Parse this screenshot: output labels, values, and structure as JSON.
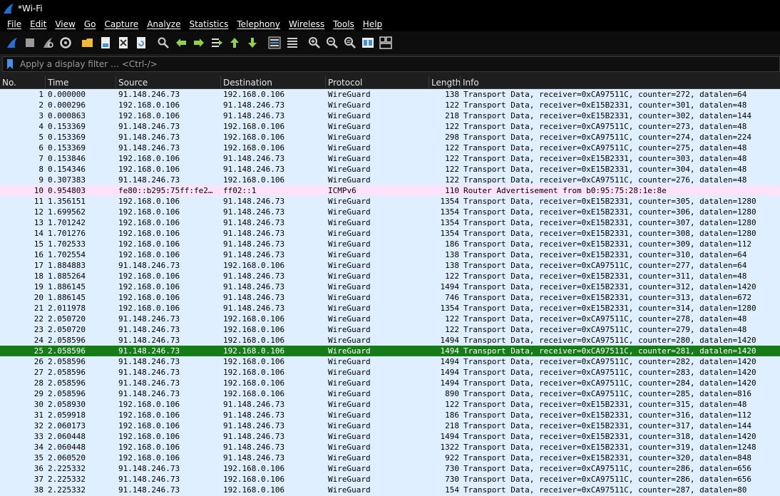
{
  "window": {
    "title": "*Wi-Fi"
  },
  "menu": [
    "File",
    "Edit",
    "View",
    "Go",
    "Capture",
    "Analyze",
    "Statistics",
    "Telephony",
    "Wireless",
    "Tools",
    "Help"
  ],
  "toolbar": [
    {
      "name": "start-capture-icon",
      "color": "#2b6fd6"
    },
    {
      "name": "stop-capture-icon",
      "color": "#9a9a9a"
    },
    {
      "name": "restart-capture-icon",
      "color": "#9a9a9a"
    },
    {
      "name": "capture-options-icon",
      "color": "#d0d0d0"
    },
    {
      "name": "open-file-icon",
      "color": "#f0b93c"
    },
    {
      "name": "save-file-icon",
      "color": "#4a90d9"
    },
    {
      "name": "close-file-icon",
      "color": "#d0d0d0"
    },
    {
      "name": "reload-file-icon",
      "color": "#4a90d9"
    },
    {
      "name": "find-packet-icon",
      "color": "#d0d0d0"
    },
    {
      "name": "go-back-icon",
      "color": "#8fd14f"
    },
    {
      "name": "go-forward-icon",
      "color": "#8fd14f"
    },
    {
      "name": "go-to-packet-icon",
      "color": "#8fd14f"
    },
    {
      "name": "go-first-packet-icon",
      "color": "#8fd14f"
    },
    {
      "name": "go-last-packet-icon",
      "color": "#8fd14f"
    },
    {
      "name": "auto-scroll-icon",
      "color": "#d0d0d0"
    },
    {
      "name": "colorize-icon",
      "color": "#d0d0d0"
    },
    {
      "name": "zoom-in-icon",
      "color": "#d0d0d0"
    },
    {
      "name": "zoom-out-icon",
      "color": "#d0d0d0"
    },
    {
      "name": "zoom-reset-icon",
      "color": "#d0d0d0"
    },
    {
      "name": "resize-columns-icon",
      "color": "#4a90d9"
    },
    {
      "name": "layout-icon",
      "color": "#d0d0d0"
    }
  ],
  "filter": {
    "placeholder": "Apply a display filter … <Ctrl-/>"
  },
  "columns": [
    "No.",
    "Time",
    "Source",
    "Destination",
    "Protocol",
    "Length",
    "Info"
  ],
  "colors": {
    "wireguard_row": "#dfefff",
    "icmp_row": "#fde3f9",
    "selected_row": "#167c16"
  },
  "packets": [
    {
      "no": "1",
      "time": "0.000000",
      "src": "91.148.246.73",
      "dst": "192.168.0.106",
      "proto": "WireGuard",
      "len": "138",
      "info": "Transport Data, receiver=0xCA97511C, counter=272, datalen=64"
    },
    {
      "no": "2",
      "time": "0.000296",
      "src": "192.168.0.106",
      "dst": "91.148.246.73",
      "proto": "WireGuard",
      "len": "122",
      "info": "Transport Data, receiver=0xE15B2331, counter=301, datalen=48"
    },
    {
      "no": "3",
      "time": "0.000863",
      "src": "192.168.0.106",
      "dst": "91.148.246.73",
      "proto": "WireGuard",
      "len": "218",
      "info": "Transport Data, receiver=0xE15B2331, counter=302, datalen=144"
    },
    {
      "no": "4",
      "time": "0.153369",
      "src": "91.148.246.73",
      "dst": "192.168.0.106",
      "proto": "WireGuard",
      "len": "122",
      "info": "Transport Data, receiver=0xCA97511C, counter=273, datalen=48"
    },
    {
      "no": "5",
      "time": "0.153369",
      "src": "91.148.246.73",
      "dst": "192.168.0.106",
      "proto": "WireGuard",
      "len": "298",
      "info": "Transport Data, receiver=0xCA97511C, counter=274, datalen=224"
    },
    {
      "no": "6",
      "time": "0.153369",
      "src": "91.148.246.73",
      "dst": "192.168.0.106",
      "proto": "WireGuard",
      "len": "122",
      "info": "Transport Data, receiver=0xCA97511C, counter=275, datalen=48"
    },
    {
      "no": "7",
      "time": "0.153846",
      "src": "192.168.0.106",
      "dst": "91.148.246.73",
      "proto": "WireGuard",
      "len": "122",
      "info": "Transport Data, receiver=0xE15B2331, counter=303, datalen=48"
    },
    {
      "no": "8",
      "time": "0.154346",
      "src": "192.168.0.106",
      "dst": "91.148.246.73",
      "proto": "WireGuard",
      "len": "122",
      "info": "Transport Data, receiver=0xE15B2331, counter=304, datalen=48"
    },
    {
      "no": "9",
      "time": "0.307383",
      "src": "91.148.246.73",
      "dst": "192.168.0.106",
      "proto": "WireGuard",
      "len": "122",
      "info": "Transport Data, receiver=0xCA97511C, counter=276, datalen=48"
    },
    {
      "no": "10",
      "time": "0.954803",
      "src": "fe80::b295:75ff:fe2…",
      "dst": "ff02::1",
      "proto": "ICMPv6",
      "len": "110",
      "info": "Router Advertisement from b0:95:75:28:1e:8e",
      "kind": "icmp"
    },
    {
      "no": "11",
      "time": "1.356151",
      "src": "192.168.0.106",
      "dst": "91.148.246.73",
      "proto": "WireGuard",
      "len": "1354",
      "info": "Transport Data, receiver=0xE15B2331, counter=305, datalen=1280"
    },
    {
      "no": "12",
      "time": "1.699562",
      "src": "192.168.0.106",
      "dst": "91.148.246.73",
      "proto": "WireGuard",
      "len": "1354",
      "info": "Transport Data, receiver=0xE15B2331, counter=306, datalen=1280"
    },
    {
      "no": "13",
      "time": "1.701242",
      "src": "192.168.0.106",
      "dst": "91.148.246.73",
      "proto": "WireGuard",
      "len": "1354",
      "info": "Transport Data, receiver=0xE15B2331, counter=307, datalen=1280"
    },
    {
      "no": "14",
      "time": "1.701276",
      "src": "192.168.0.106",
      "dst": "91.148.246.73",
      "proto": "WireGuard",
      "len": "1354",
      "info": "Transport Data, receiver=0xE15B2331, counter=308, datalen=1280"
    },
    {
      "no": "15",
      "time": "1.702533",
      "src": "192.168.0.106",
      "dst": "91.148.246.73",
      "proto": "WireGuard",
      "len": "186",
      "info": "Transport Data, receiver=0xE15B2331, counter=309, datalen=112"
    },
    {
      "no": "16",
      "time": "1.702554",
      "src": "192.168.0.106",
      "dst": "91.148.246.73",
      "proto": "WireGuard",
      "len": "138",
      "info": "Transport Data, receiver=0xE15B2331, counter=310, datalen=64"
    },
    {
      "no": "17",
      "time": "1.884883",
      "src": "91.148.246.73",
      "dst": "192.168.0.106",
      "proto": "WireGuard",
      "len": "138",
      "info": "Transport Data, receiver=0xCA97511C, counter=277, datalen=64"
    },
    {
      "no": "18",
      "time": "1.885264",
      "src": "192.168.0.106",
      "dst": "91.148.246.73",
      "proto": "WireGuard",
      "len": "122",
      "info": "Transport Data, receiver=0xE15B2331, counter=311, datalen=48"
    },
    {
      "no": "19",
      "time": "1.886145",
      "src": "192.168.0.106",
      "dst": "91.148.246.73",
      "proto": "WireGuard",
      "len": "1494",
      "info": "Transport Data, receiver=0xE15B2331, counter=312, datalen=1420"
    },
    {
      "no": "20",
      "time": "1.886145",
      "src": "192.168.0.106",
      "dst": "91.148.246.73",
      "proto": "WireGuard",
      "len": "746",
      "info": "Transport Data, receiver=0xE15B2331, counter=313, datalen=672"
    },
    {
      "no": "21",
      "time": "2.011978",
      "src": "192.168.0.106",
      "dst": "91.148.246.73",
      "proto": "WireGuard",
      "len": "1354",
      "info": "Transport Data, receiver=0xE15B2331, counter=314, datalen=1280"
    },
    {
      "no": "22",
      "time": "2.050720",
      "src": "91.148.246.73",
      "dst": "192.168.0.106",
      "proto": "WireGuard",
      "len": "122",
      "info": "Transport Data, receiver=0xCA97511C, counter=278, datalen=48"
    },
    {
      "no": "23",
      "time": "2.050720",
      "src": "91.148.246.73",
      "dst": "192.168.0.106",
      "proto": "WireGuard",
      "len": "122",
      "info": "Transport Data, receiver=0xCA97511C, counter=279, datalen=48"
    },
    {
      "no": "24",
      "time": "2.058596",
      "src": "91.148.246.73",
      "dst": "192.168.0.106",
      "proto": "WireGuard",
      "len": "1494",
      "info": "Transport Data, receiver=0xCA97511C, counter=280, datalen=1420"
    },
    {
      "no": "25",
      "time": "2.058596",
      "src": "91.148.246.73",
      "dst": "192.168.0.106",
      "proto": "WireGuard",
      "len": "1494",
      "info": "Transport Data, receiver=0xCA97511C, counter=281, datalen=1420",
      "kind": "selected"
    },
    {
      "no": "26",
      "time": "2.058596",
      "src": "91.148.246.73",
      "dst": "192.168.0.106",
      "proto": "WireGuard",
      "len": "1494",
      "info": "Transport Data, receiver=0xCA97511C, counter=282, datalen=1420"
    },
    {
      "no": "27",
      "time": "2.058596",
      "src": "91.148.246.73",
      "dst": "192.168.0.106",
      "proto": "WireGuard",
      "len": "1494",
      "info": "Transport Data, receiver=0xCA97511C, counter=283, datalen=1420"
    },
    {
      "no": "28",
      "time": "2.058596",
      "src": "91.148.246.73",
      "dst": "192.168.0.106",
      "proto": "WireGuard",
      "len": "1494",
      "info": "Transport Data, receiver=0xCA97511C, counter=284, datalen=1420"
    },
    {
      "no": "29",
      "time": "2.058596",
      "src": "91.148.246.73",
      "dst": "192.168.0.106",
      "proto": "WireGuard",
      "len": "890",
      "info": "Transport Data, receiver=0xCA97511C, counter=285, datalen=816"
    },
    {
      "no": "30",
      "time": "2.058930",
      "src": "192.168.0.106",
      "dst": "91.148.246.73",
      "proto": "WireGuard",
      "len": "122",
      "info": "Transport Data, receiver=0xE15B2331, counter=315, datalen=48"
    },
    {
      "no": "31",
      "time": "2.059918",
      "src": "192.168.0.106",
      "dst": "91.148.246.73",
      "proto": "WireGuard",
      "len": "186",
      "info": "Transport Data, receiver=0xE15B2331, counter=316, datalen=112"
    },
    {
      "no": "32",
      "time": "2.060173",
      "src": "192.168.0.106",
      "dst": "91.148.246.73",
      "proto": "WireGuard",
      "len": "218",
      "info": "Transport Data, receiver=0xE15B2331, counter=317, datalen=144"
    },
    {
      "no": "33",
      "time": "2.060448",
      "src": "192.168.0.106",
      "dst": "91.148.246.73",
      "proto": "WireGuard",
      "len": "1494",
      "info": "Transport Data, receiver=0xE15B2331, counter=318, datalen=1420"
    },
    {
      "no": "34",
      "time": "2.060448",
      "src": "192.168.0.106",
      "dst": "91.148.246.73",
      "proto": "WireGuard",
      "len": "1322",
      "info": "Transport Data, receiver=0xE15B2331, counter=319, datalen=1248"
    },
    {
      "no": "35",
      "time": "2.060520",
      "src": "192.168.0.106",
      "dst": "91.148.246.73",
      "proto": "WireGuard",
      "len": "922",
      "info": "Transport Data, receiver=0xE15B2331, counter=320, datalen=848"
    },
    {
      "no": "36",
      "time": "2.225332",
      "src": "91.148.246.73",
      "dst": "192.168.0.106",
      "proto": "WireGuard",
      "len": "730",
      "info": "Transport Data, receiver=0xCA97511C, counter=286, datalen=656"
    },
    {
      "no": "37",
      "time": "2.225332",
      "src": "91.148.246.73",
      "dst": "192.168.0.106",
      "proto": "WireGuard",
      "len": "730",
      "info": "Transport Data, receiver=0xCA97511C, counter=286, datalen=656"
    },
    {
      "no": "38",
      "time": "2.225332",
      "src": "91.148.246.73",
      "dst": "192.168.0.106",
      "proto": "WireGuard",
      "len": "154",
      "info": "Transport Data, receiver=0xCA97511C, counter=287, datalen=80"
    }
  ]
}
